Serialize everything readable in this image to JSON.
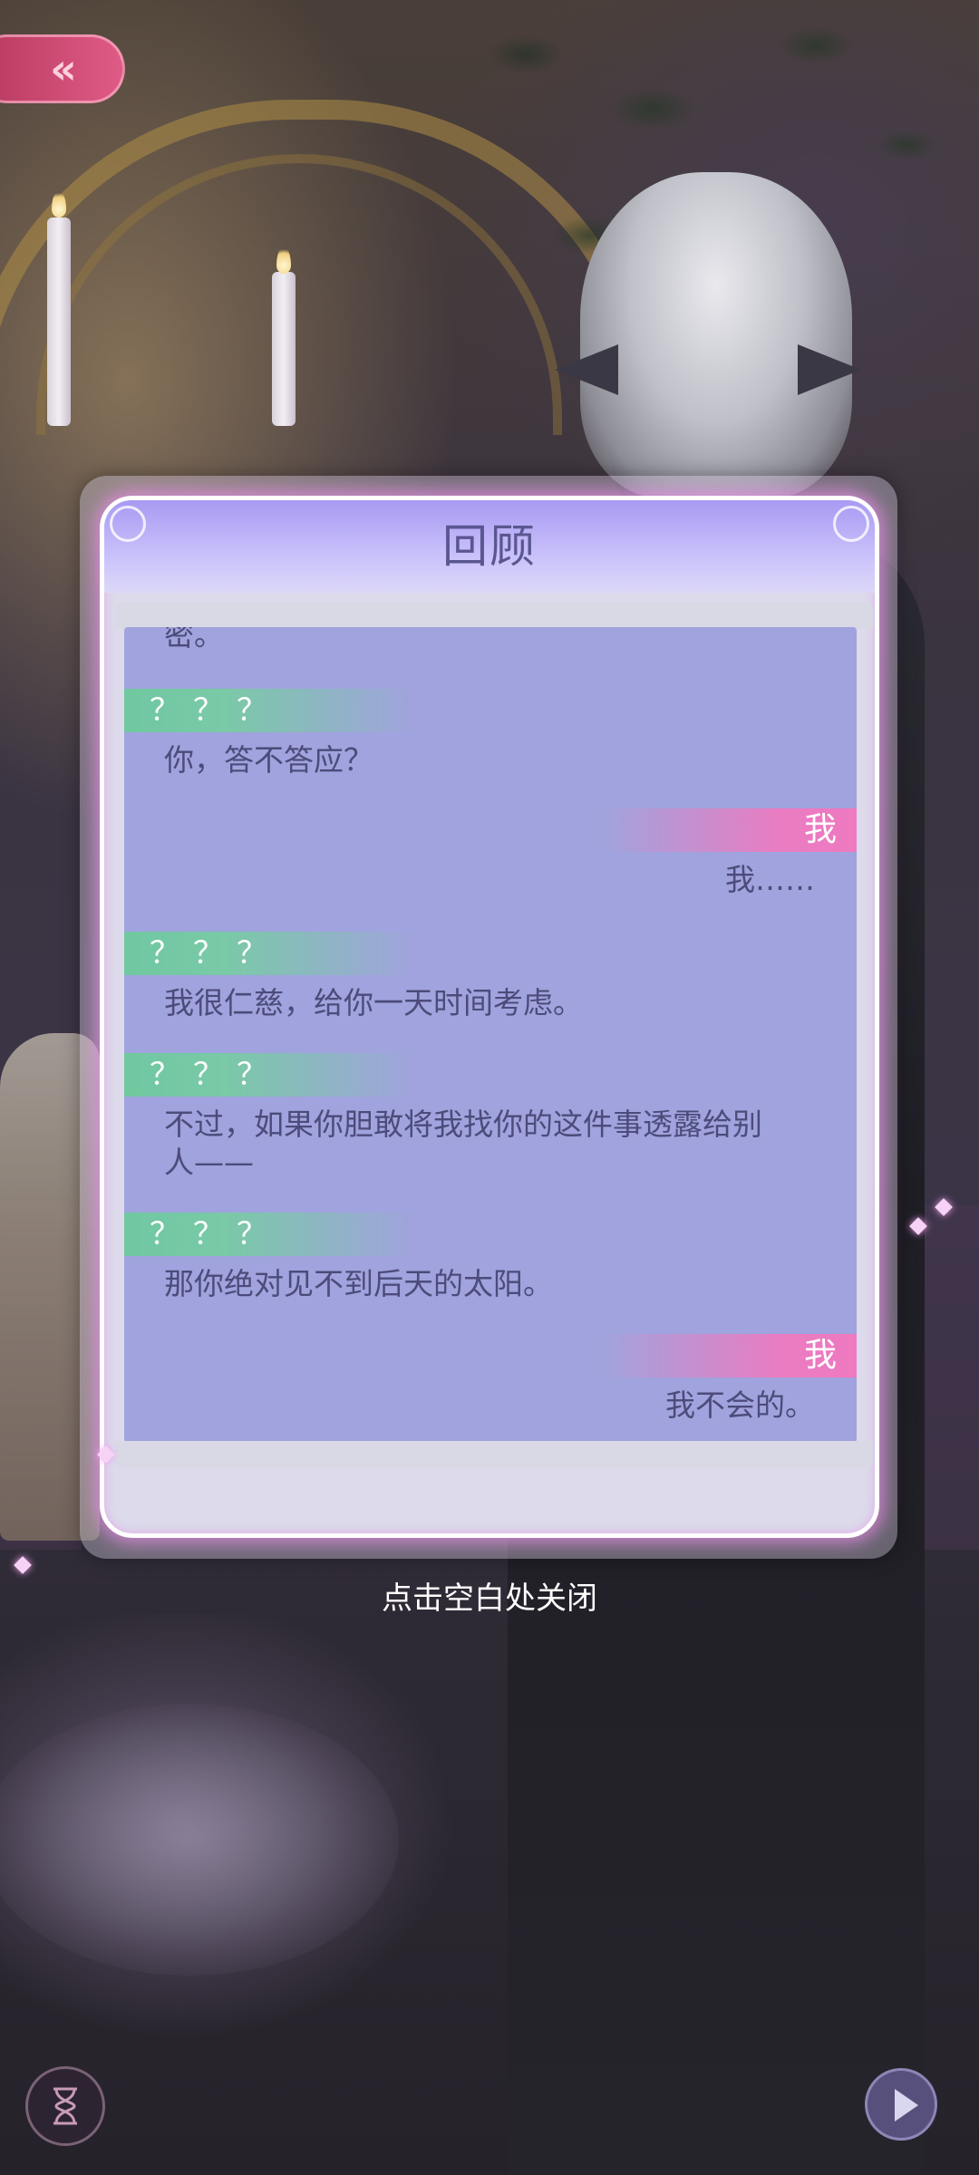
{
  "dialog": {
    "title": "回顾",
    "entries": [
      {
        "speaker": "",
        "side": "left",
        "lines": [
          "密。"
        ]
      },
      {
        "speaker": "？？？",
        "side": "left",
        "lines": [
          "你，答不答应？"
        ]
      },
      {
        "speaker": "我",
        "side": "right",
        "lines": [
          "我……"
        ]
      },
      {
        "speaker": "？？？",
        "side": "left",
        "lines": [
          "我很仁慈，给你一天时间考虑。"
        ]
      },
      {
        "speaker": "？？？",
        "side": "left",
        "lines": [
          "不过，如果你胆敢将我找你的这件事透露给别",
          "人——"
        ]
      },
      {
        "speaker": "？？？",
        "side": "left",
        "lines": [
          "那你绝对见不到后天的太阳。"
        ]
      },
      {
        "speaker": "我",
        "side": "right",
        "lines": [
          "我不会的。"
        ]
      }
    ]
  },
  "close_hint": "点击空白处关闭",
  "controls": {
    "back_icon": "double-chevron-left-icon",
    "hourglass_icon": "hourglass-icon",
    "play_icon": "play-icon"
  },
  "colors": {
    "speaker_unknown": "#6fc8a0",
    "speaker_me": "#ee7ac0",
    "log_background": "#a0a3dd",
    "dialog_header": "#a89af2",
    "back_button": "#df5b86"
  }
}
